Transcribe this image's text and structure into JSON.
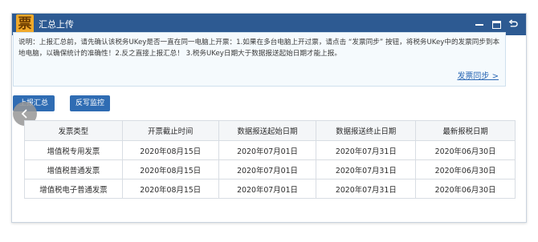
{
  "window": {
    "logo_char": "票",
    "title": "汇总上传"
  },
  "notice": {
    "text": "说明：上报汇总前，请先确认该税务UKey是否一直在同一电脑上开票：1.如果在多台电脑上开过票，请点击 “发票同步” 按钮，将税务UKey中的发票同步到本地电脑，以确保统计的准确性！2.反之直接上报汇总！ 3.税务UKey日期大于数据报送起始日期才能上报。",
    "sync_link": "发票同步 >"
  },
  "actions": {
    "upload_label": "上报汇总",
    "monitor_label": "反写监控"
  },
  "table": {
    "headers": [
      "发票类型",
      "开票截止时间",
      "数据报送起始日期",
      "数据报送终止日期",
      "最新报税日期"
    ],
    "rows": [
      [
        "增值税专用发票",
        "2020年08月15日",
        "2020年07月01日",
        "2020年07月31日",
        "2020年06月30日"
      ],
      [
        "增值税普通发票",
        "2020年08月15日",
        "2020年07月01日",
        "2020年07月31日",
        "2020年06月30日"
      ],
      [
        "增值税电子普通发票",
        "2020年08月15日",
        "2020年07月01日",
        "2020年07月31日",
        "2020年06月30日"
      ]
    ]
  },
  "colors": {
    "titlebar": "#2d5a92",
    "button": "#2f6cb3",
    "link": "#2a67b4"
  }
}
